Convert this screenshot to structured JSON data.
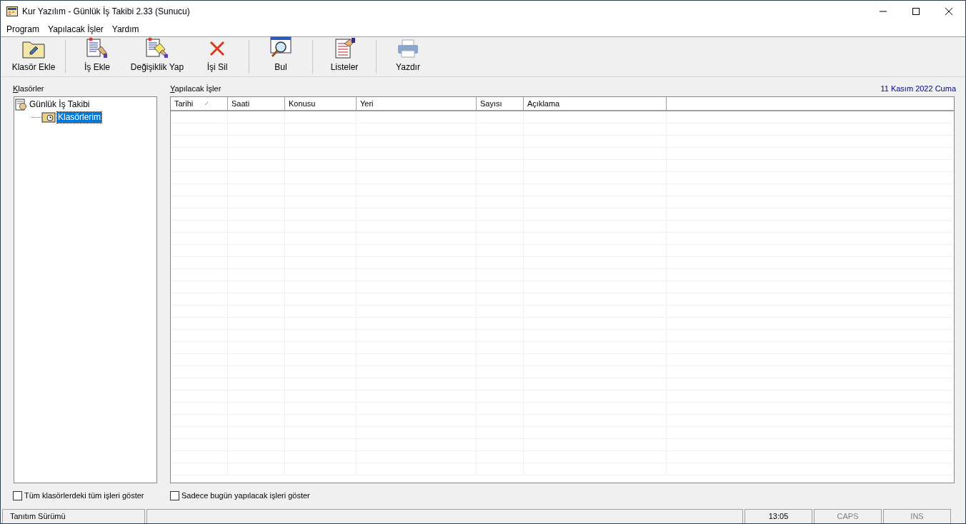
{
  "window": {
    "title": "Kur Yazılım - Günlük İş Takibi 2.33 (Sunucu)"
  },
  "menu": [
    "Program",
    "Yapılacak İşler",
    "Yardım"
  ],
  "toolbar": [
    [
      {
        "kind": "folder",
        "label": "Klasör Ekle"
      }
    ],
    [
      {
        "kind": "add",
        "label": "İş Ekle"
      },
      {
        "kind": "edit",
        "label": "Değişiklik Yap"
      },
      {
        "kind": "delete",
        "label": "İşi Sil"
      }
    ],
    [
      {
        "kind": "find",
        "label": "Bul"
      }
    ],
    [
      {
        "kind": "list",
        "label": "Listeler"
      }
    ],
    [
      {
        "kind": "print",
        "label": "Yazdır"
      }
    ]
  ],
  "folders": {
    "label": "Klasörler",
    "tree": [
      {
        "label": "Günlük İş Takibi",
        "selected": false,
        "children": [
          {
            "label": "Klasörlerim",
            "selected": true
          }
        ]
      }
    ]
  },
  "tasks": {
    "label": "Yapılacak İşler",
    "date": "11 Kasım 2022 Cuma",
    "columns": [
      {
        "label": "Tarihi",
        "sorted": true
      },
      {
        "label": "Saati",
        "sorted": false
      },
      {
        "label": "Konusu",
        "sorted": false
      },
      {
        "label": "Yeri",
        "sorted": false
      },
      {
        "label": "Sayısı",
        "sorted": false
      },
      {
        "label": "Açıklama",
        "sorted": false
      }
    ]
  },
  "options": [
    {
      "label": "Tüm klasörlerdeki tüm işleri göster",
      "checked": false
    },
    {
      "label": "Sadece bugün yapılacak işleri göster",
      "checked": false
    }
  ],
  "status_bar": [
    {
      "text": "Tanıtım Sürümü",
      "active": true
    },
    {
      "text": "13:05",
      "active": true
    },
    {
      "text": "CAPS",
      "active": false
    },
    {
      "text": "INS",
      "active": false
    }
  ]
}
